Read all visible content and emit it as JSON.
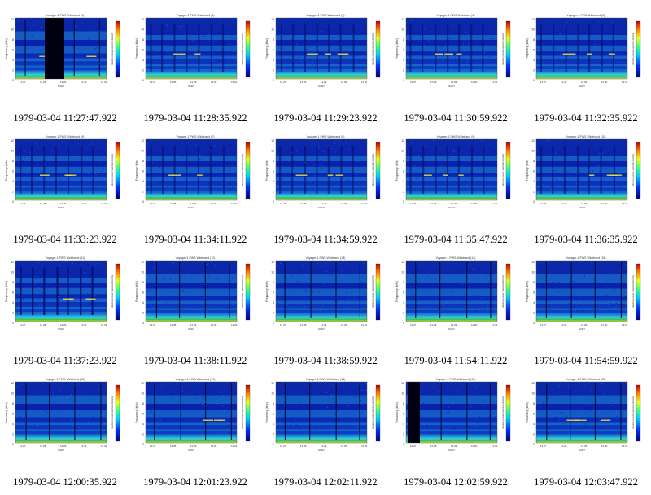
{
  "gallery": {
    "columns": 5,
    "thumbnail_title": "Voyager-1 PWS Wideband",
    "colorbar_label": "relative power spectral density",
    "frequency_axis_label": "Frequency (kHz)",
    "frequency_ticks": [
      "12",
      "10",
      "8",
      "6",
      "4",
      "2",
      "0"
    ],
    "scet_label": "SCET",
    "colors": {
      "background": "#ffffff",
      "spectrogram_base": "#0a1fae",
      "band_bright": "#1e8bd8",
      "band_cyan": "#30d0e0",
      "gap_black": "#000010",
      "low_green": "#3fbf4f",
      "low_yellow": "#e8e040"
    },
    "tiles": [
      {
        "caption": "1979-03-04 11:27:47.922",
        "gap": "wide",
        "features": "band-edges"
      },
      {
        "caption": "1979-03-04 11:28:35.922",
        "gap": "none",
        "features": "bursts"
      },
      {
        "caption": "1979-03-04 11:29:23.922",
        "gap": "none",
        "features": "bursts"
      },
      {
        "caption": "1979-03-04 11:30:59.922",
        "gap": "none",
        "features": "bursts"
      },
      {
        "caption": "1979-03-04 11:32:35.922",
        "gap": "none",
        "features": "bursts"
      },
      {
        "caption": "1979-03-04 11:33:23.922",
        "gap": "none",
        "features": "bursts"
      },
      {
        "caption": "1979-03-04 11:34:11.922",
        "gap": "none",
        "features": "bursts"
      },
      {
        "caption": "1979-03-04 11:34:59.922",
        "gap": "none",
        "features": "bursts"
      },
      {
        "caption": "1979-03-04 11:35:47.922",
        "gap": "none",
        "features": "bursts"
      },
      {
        "caption": "1979-03-04 11:36:35.922",
        "gap": "none",
        "features": "bursts"
      },
      {
        "caption": "1979-03-04 11:37:23.922",
        "gap": "none",
        "features": "bursts-dark"
      },
      {
        "caption": "1979-03-04 11:38:11.922",
        "gap": "none",
        "features": "diffuse"
      },
      {
        "caption": "1979-03-04 11:38:59.922",
        "gap": "none",
        "features": "diffuse"
      },
      {
        "caption": "1979-03-04 11:54:11.922",
        "gap": "none",
        "features": "diffuse"
      },
      {
        "caption": "1979-03-04 11:54:59.922",
        "gap": "none",
        "features": "diffuse"
      },
      {
        "caption": "1979-03-04 12:00:35.922",
        "gap": "none",
        "features": "diffuse"
      },
      {
        "caption": "1979-03-04 12:01:23.922",
        "gap": "none",
        "features": "diffuse-lines"
      },
      {
        "caption": "1979-03-04 12:02:11.922",
        "gap": "none",
        "features": "diffuse"
      },
      {
        "caption": "1979-03-04 12:02:59.922",
        "gap": "left",
        "features": "diffuse"
      },
      {
        "caption": "1979-03-04 12:03:47.922",
        "gap": "none",
        "features": "diffuse-lines"
      }
    ]
  }
}
